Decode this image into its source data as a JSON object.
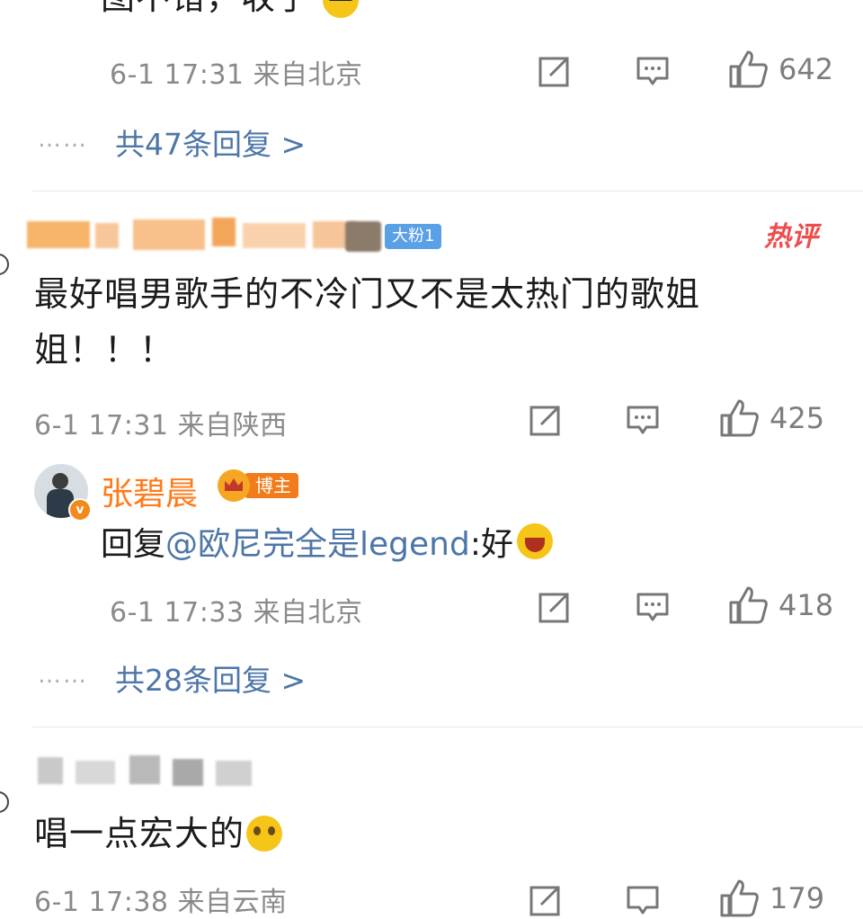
{
  "comments": [
    {
      "text": "图不错，收了",
      "meta": "6-1 17:31 来自北京",
      "likes": "642",
      "replies": "共47条回复 >"
    },
    {
      "user_badge": "大粉1",
      "hot_label": "热评",
      "text_line1": "最好唱男歌手的不冷门又不是太热门的歌姐",
      "text_line2": "姐！！！",
      "meta": "6-1 17:31 来自陕西",
      "likes": "425",
      "author_reply": {
        "name": "张碧晨",
        "badge": "博主",
        "prefix": "回复",
        "mention": "@欧尼完全是legend",
        "suffix": ":好",
        "meta": "6-1 17:33 来自北京",
        "likes": "418"
      },
      "replies": "共28条回复 >"
    },
    {
      "text": "唱一点宏大的",
      "meta": "6-1 17:38 来自云南",
      "likes": "179"
    }
  ],
  "more_dots": "……",
  "colors": {
    "link": "#4d76a8",
    "hot": "#ee4d4d",
    "author": "#ff7a1a",
    "meta": "#8a8a8a"
  }
}
